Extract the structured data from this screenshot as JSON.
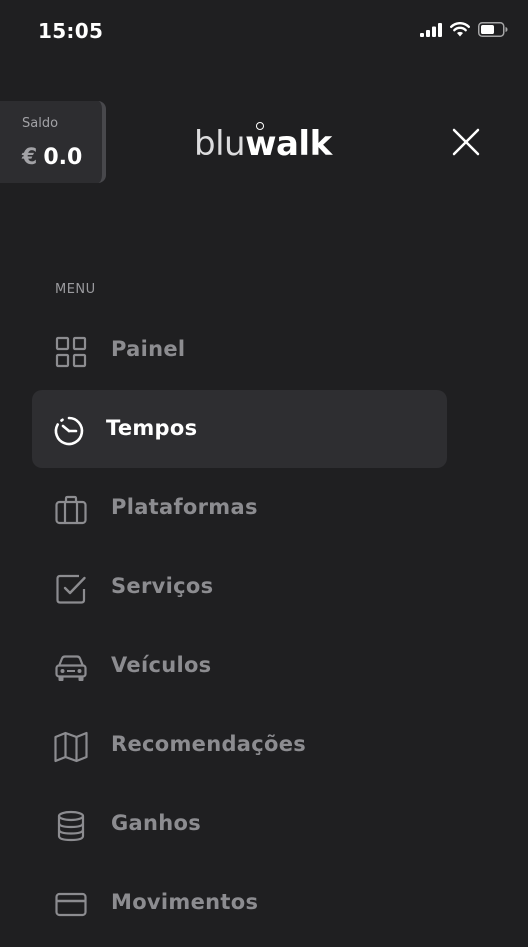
{
  "status_bar": {
    "time": "15:05",
    "icons": [
      "signal-icon",
      "wifi-icon",
      "battery-icon"
    ]
  },
  "balance": {
    "label": "Saldo",
    "currency": "€",
    "amount": "0.0"
  },
  "logo": {
    "light_part": "blu",
    "bold_part": "walk"
  },
  "menu": {
    "header": "MENU",
    "items": [
      {
        "label": "Painel",
        "icon": "grid-icon",
        "active": false
      },
      {
        "label": "Tempos",
        "icon": "timer-icon",
        "active": true
      },
      {
        "label": "Plataformas",
        "icon": "briefcase-icon",
        "active": false
      },
      {
        "label": "Serviços",
        "icon": "checkbox-icon",
        "active": false
      },
      {
        "label": "Veículos",
        "icon": "car-icon",
        "active": false
      },
      {
        "label": "Recomendações",
        "icon": "map-icon",
        "active": false
      },
      {
        "label": "Ganhos",
        "icon": "database-icon",
        "active": false
      },
      {
        "label": "Movimentos",
        "icon": "credit-card-icon",
        "active": false
      }
    ]
  },
  "colors": {
    "background": "#1f1f21",
    "active_item": "#2e2e31",
    "inactive_text": "#8c8c90",
    "active_text": "#ffffff"
  }
}
